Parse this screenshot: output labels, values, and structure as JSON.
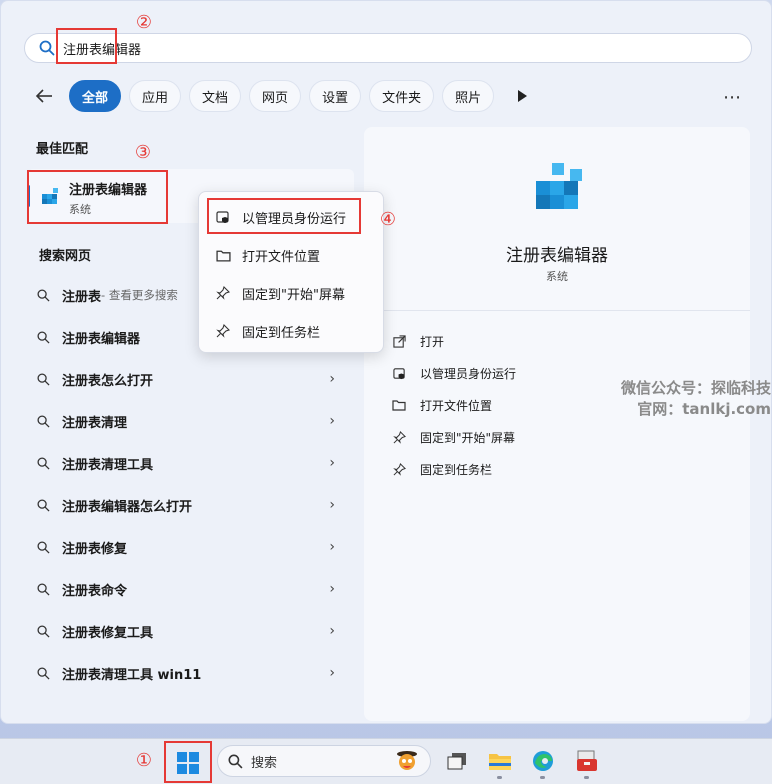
{
  "search": {
    "query": "注册表编辑器",
    "placeholder": "注册表编辑器"
  },
  "filters": {
    "back_label": "←",
    "chips": [
      "全部",
      "应用",
      "文档",
      "网页",
      "设置",
      "文件夹",
      "照片"
    ],
    "active_index": 0,
    "more_label": "⋯"
  },
  "best_match": {
    "section_title": "最佳匹配",
    "app_name": "注册表编辑器",
    "app_type": "系统"
  },
  "web_search": {
    "section_title": "搜索网页",
    "results": [
      {
        "label": "注册表",
        "sub": " - 查看更多搜索"
      },
      {
        "label": "注册表编辑器",
        "sub": ""
      },
      {
        "label": "注册表怎么打开",
        "sub": ""
      },
      {
        "label": "注册表清理",
        "sub": ""
      },
      {
        "label": "注册表清理工具",
        "sub": ""
      },
      {
        "label": "注册表编辑器怎么打开",
        "sub": ""
      },
      {
        "label": "注册表修复",
        "sub": ""
      },
      {
        "label": "注册表命令",
        "sub": ""
      },
      {
        "label": "注册表修复工具",
        "sub": ""
      },
      {
        "label": "注册表清理工具 win11",
        "sub": ""
      }
    ],
    "chevron": "›"
  },
  "context_menu": {
    "items": [
      {
        "label": "以管理员身份运行",
        "icon": "shield-icon"
      },
      {
        "label": "打开文件位置",
        "icon": "folder-icon"
      },
      {
        "label": "固定到\"开始\"屏幕",
        "icon": "pin-icon"
      },
      {
        "label": "固定到任务栏",
        "icon": "pin-icon"
      }
    ]
  },
  "detail": {
    "title": "注册表编辑器",
    "subtitle": "系统",
    "actions": [
      {
        "label": "打开",
        "icon": "open-icon"
      },
      {
        "label": "以管理员身份运行",
        "icon": "shield-icon"
      },
      {
        "label": "打开文件位置",
        "icon": "folder-icon"
      },
      {
        "label": "固定到\"开始\"屏幕",
        "icon": "pin-icon"
      },
      {
        "label": "固定到任务栏",
        "icon": "pin-icon"
      }
    ]
  },
  "watermark": {
    "line1": "微信公众号：探临科技",
    "line2": "官网：tanlkj.com"
  },
  "annotations": {
    "marker1": "①",
    "marker2": "②",
    "marker3": "③",
    "marker4": "④",
    "color": "#e53935"
  },
  "taskbar": {
    "search_label": "搜索",
    "apps": [
      "start-icon",
      "task-view-icon",
      "file-explorer-icon",
      "edge-icon",
      "toolbox-icon"
    ]
  },
  "colors": {
    "accent": "#1d6ec6",
    "panel_bg": "#edf1f9",
    "card_bg": "#f6f8fc"
  }
}
